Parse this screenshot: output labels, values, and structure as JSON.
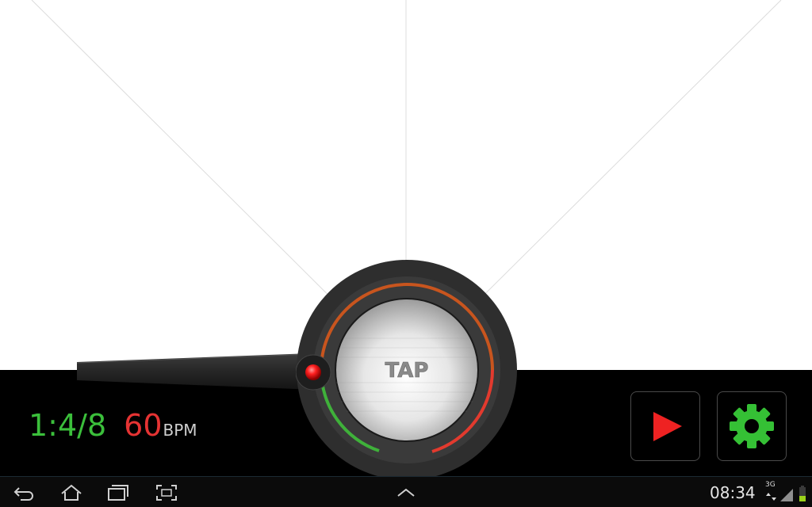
{
  "metronome": {
    "time_signature": "1:4/8",
    "tempo": "60",
    "tempo_unit": "BPM",
    "tap_label": "TAP"
  },
  "controls": {
    "play_icon": "play-icon",
    "settings_icon": "gear-icon"
  },
  "colors": {
    "background_top": "#ffffff",
    "panel": "#000000",
    "time_signature": "#3bbf3b",
    "tempo": "#e53333",
    "play_accent": "#ee2222",
    "settings_accent": "#35c035",
    "dial_ring": "#2e2e2e",
    "arc_red": "#e23a2e",
    "arc_orange": "#c8551e",
    "arc_green": "#3fb13a",
    "indicator_led": "#ff2020"
  },
  "status_bar": {
    "time": "08:34",
    "network": "3G",
    "nav_icons": [
      "back-icon",
      "home-icon",
      "recent-apps-icon",
      "screenshot-icon",
      "chevron-up-icon"
    ]
  }
}
